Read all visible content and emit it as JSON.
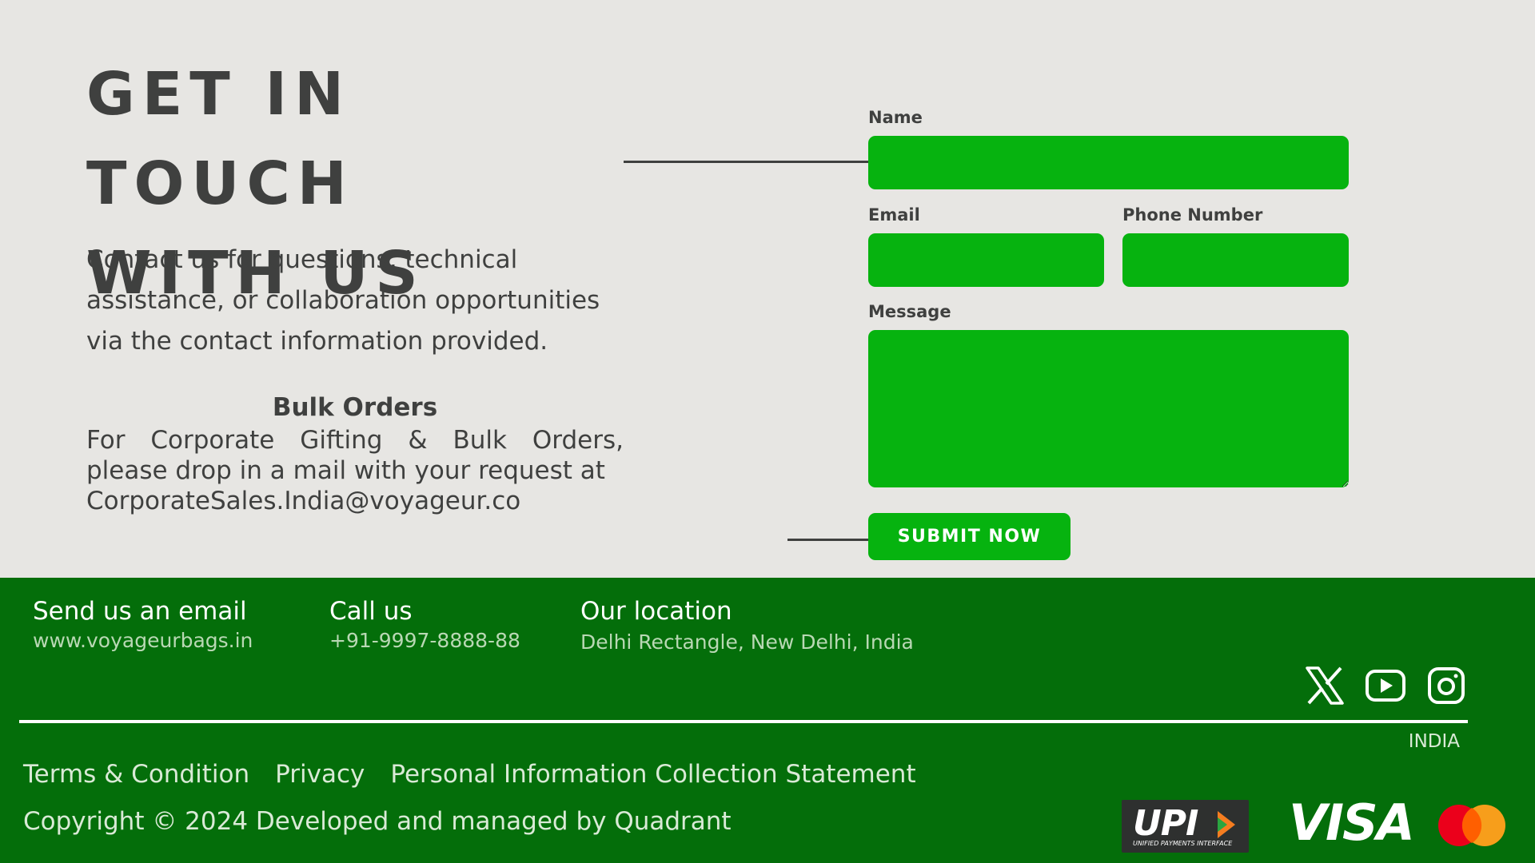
{
  "contact": {
    "heading_line1": "GET IN TOUCH",
    "heading_line2": "WITH US",
    "intro": "Contact us for questions, technical assistance, or collaboration opportunities via the contact information provided.",
    "bulk_title": "Bulk Orders",
    "bulk_text": "For Corporate Gifting & Bulk Orders, please drop in a mail with your request at",
    "bulk_email": "CorporateSales.India@voyageur.co"
  },
  "form": {
    "name_label": "Name",
    "name_value": "",
    "email_label": "Email",
    "email_value": "",
    "phone_label": "Phone Number",
    "phone_value": "",
    "message_label": "Message",
    "message_value": "",
    "submit_label": "SUBMIT NOW",
    "field_color": "#06b30f"
  },
  "footer": {
    "email_title": "Send us an email",
    "email_value": "www.voyageurbags.in",
    "call_title": "Call us",
    "call_value": "+91-9997-8888-88",
    "location_title": "Our location",
    "location_value": "Delhi Rectangle, New Delhi, India",
    "social_icons": [
      "x-icon",
      "youtube-icon",
      "instagram-icon"
    ],
    "country": "INDIA",
    "links": [
      "Terms & Condition",
      "Privacy",
      "Personal Information Collection Statement"
    ],
    "copyright": "Copyright © 2024 Developed and managed by Quadrant",
    "payment_logos": [
      "upi-logo",
      "visa-logo",
      "mastercard-logo"
    ],
    "upi_text": "UPI",
    "upi_subtext": "UNIFIED PAYMENTS INTERFACE",
    "visa_text": "VISA",
    "background_color": "#046e0a"
  }
}
